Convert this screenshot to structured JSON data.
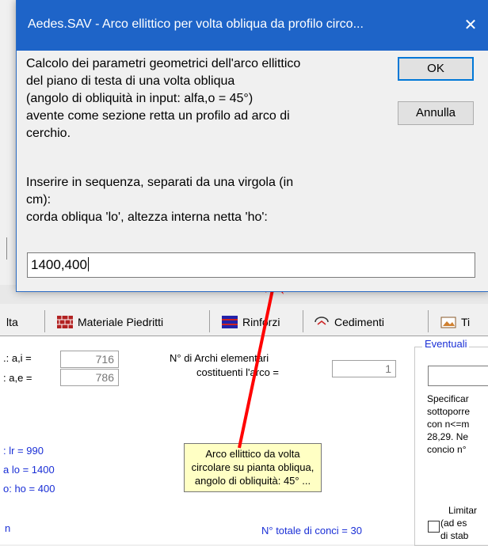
{
  "dialog": {
    "title": "Aedes.SAV - Arco ellittico per volta obliqua da profilo circo...",
    "close_glyph": "✕",
    "message_lines": [
      "Calcolo dei parametri geometrici dell'arco ellittico",
      "del piano di testa di una volta obliqua",
      "(angolo di obliquità in input: alfa,o = 45°)",
      "avente come sezione retta un profilo ad arco di",
      "cerchio.",
      "Inserire in sequenza, separati da una virgola (in",
      "cm):",
      "corda obliqua 'lo', altezza interna netta 'ho':"
    ],
    "ok_label": "OK",
    "cancel_label": "Annulla",
    "input_value": "1400,400"
  },
  "tabs": [
    {
      "label": "lta",
      "icon": "none"
    },
    {
      "label": "Materiale Piedritti",
      "icon": "brick-wall-icon"
    },
    {
      "label": "Rinforzi",
      "icon": "reinforcement-icon"
    },
    {
      "label": "Cedimenti",
      "icon": "settlement-icon"
    },
    {
      "label": "Ti",
      "icon": "image-icon"
    }
  ],
  "panel": {
    "ai_label": ".: a,i =",
    "ai_value": "716",
    "ae_label": ": a,e =",
    "ae_value": "786",
    "lr_text": ": lr = 990",
    "lo_text": "a lo = 1400",
    "ho_text": "o: ho = 400",
    "n_text": "n",
    "archi_label_1": "N° di Archi elementari",
    "archi_label_2": "costituenti l'arco =",
    "archi_value": "1",
    "totale_conci": "N° totale di conci = 30",
    "group_title": "Eventuali",
    "group_lines": [
      "Specificar",
      "sottoporre",
      "con n<=m",
      "28,29. Ne",
      "concio n°"
    ],
    "limit_lines": [
      "Limitar",
      "(ad es",
      "di stab"
    ]
  },
  "tooltip_lines": [
    "Arco ellittico da volta",
    "circolare su pianta obliqua,",
    "angolo di obliquità: 45° ..."
  ],
  "colors": {
    "titlebar": "#1e64c8",
    "arrow": "#ff0000",
    "blue_text": "#1a2fd6",
    "tooltip_bg": "#ffffc4"
  }
}
